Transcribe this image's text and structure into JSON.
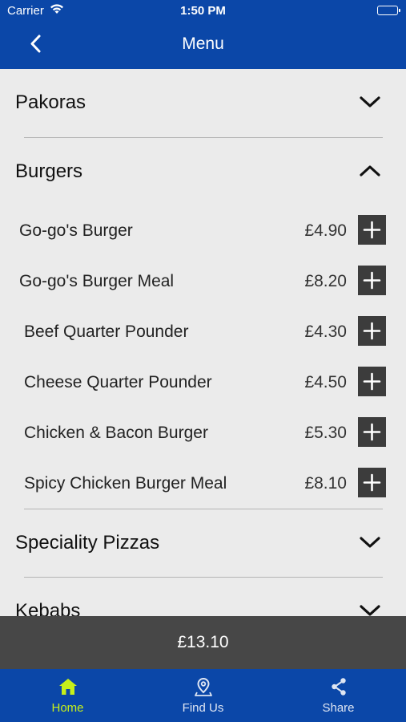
{
  "status_bar": {
    "carrier": "Carrier",
    "time": "1:50 PM"
  },
  "nav": {
    "title": "Menu",
    "back_icon": "chevron-left-icon"
  },
  "categories": [
    {
      "label": "Pakoras",
      "state": "collapsed"
    },
    {
      "label": "Burgers",
      "state": "expanded"
    },
    {
      "label": "Speciality Pizzas",
      "state": "collapsed"
    },
    {
      "label": "Kebabs",
      "state": "collapsed"
    }
  ],
  "burgers": [
    {
      "name": "Go-go's Burger",
      "price": "£4.90"
    },
    {
      "name": "Go-go's Burger Meal",
      "price": "£8.20"
    },
    {
      "name": "Beef Quarter Pounder",
      "price": "£4.30"
    },
    {
      "name": "Cheese Quarter Pounder",
      "price": "£4.50"
    },
    {
      "name": "Chicken & Bacon Burger",
      "price": "£5.30"
    },
    {
      "name": "Spicy Chicken Burger Meal",
      "price": "£8.10"
    }
  ],
  "basket": {
    "total": "£13.10"
  },
  "tabs": [
    {
      "label": "Home",
      "icon": "home-icon",
      "active": true
    },
    {
      "label": "Find Us",
      "icon": "map-pin-icon",
      "active": false
    },
    {
      "label": "Share",
      "icon": "share-icon",
      "active": false
    }
  ],
  "colors": {
    "brand_blue": "#0b47a8",
    "active_tab": "#c6f01a",
    "basket_bar": "#474747",
    "add_button": "#3c3c3c"
  }
}
